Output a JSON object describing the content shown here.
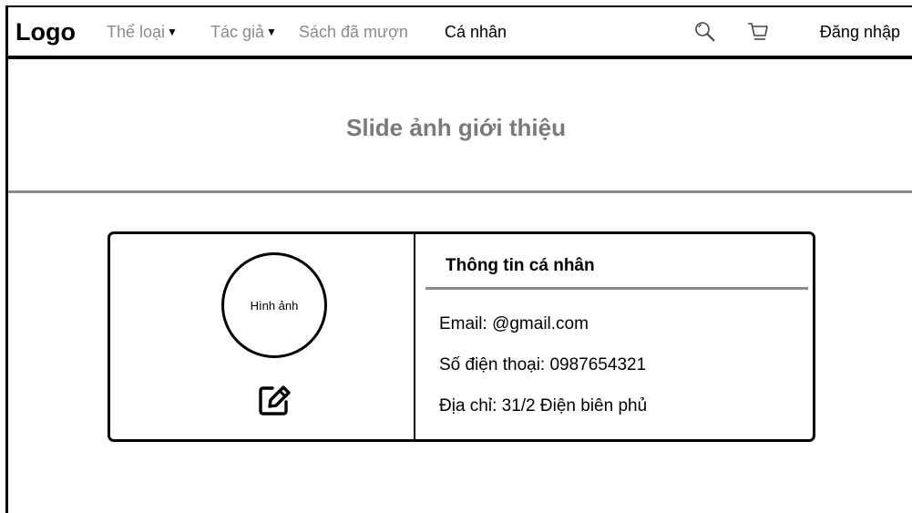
{
  "navbar": {
    "logo": "Logo",
    "items": [
      {
        "label": "Thể loại",
        "has_dropdown": true,
        "active": false
      },
      {
        "label": "Tác giả",
        "has_dropdown": true,
        "active": false
      },
      {
        "label": "Sách đã mượn",
        "has_dropdown": false,
        "active": false
      },
      {
        "label": "Cá nhân",
        "has_dropdown": false,
        "active": true
      }
    ],
    "search_icon": "search-icon",
    "cart_icon": "cart-icon",
    "login_label": "Đăng nhập"
  },
  "banner": {
    "title": "Slide ảnh giới thiệu"
  },
  "profile": {
    "avatar_label": "Hình ảnh",
    "edit_icon": "edit-icon",
    "section_title": "Thông tin cá nhân",
    "email": "Email: @gmail.com",
    "phone": "Số điện thoại: 0987654321",
    "address": "Địa chỉ: 31/2 Điện biên phủ"
  },
  "colors": {
    "inactive_nav": "#8a8a8a",
    "banner_text": "#7a7a7a",
    "divider_gray": "#8a8a8a",
    "border": "#000000"
  }
}
